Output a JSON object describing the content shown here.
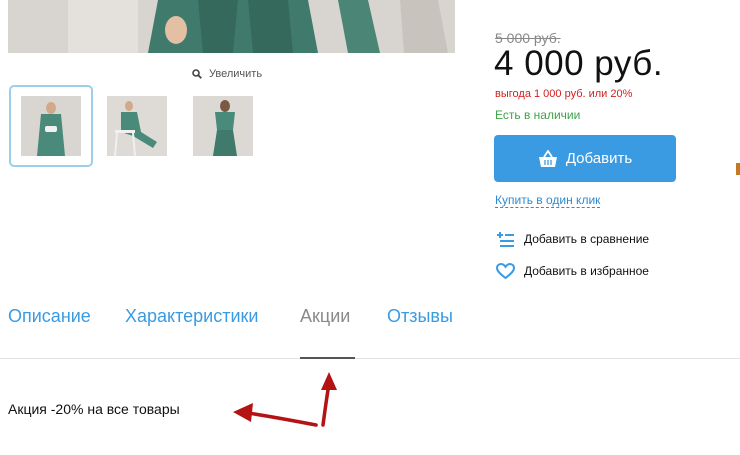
{
  "gallery": {
    "zoom_label": "Увеличить",
    "zoom_icon": "magnifier-icon",
    "thumbnails": [
      "thumb-front",
      "thumb-sitting",
      "thumb-back"
    ]
  },
  "buy_box": {
    "old_price": "5 000 руб.",
    "price": "4 000 руб.",
    "saving": "выгода 1 000 руб. или 20%",
    "stock": "Есть в наличии",
    "add_button_label": "Добавить",
    "add_button_icon": "basket-icon",
    "one_click_label": "Купить в один клик",
    "compare_label": "Добавить в сравнение",
    "compare_icon": "compare-list-icon",
    "favorite_label": "Добавить в избранное",
    "favorite_icon": "heart-icon"
  },
  "tabs": [
    {
      "label": "Описание",
      "active": false
    },
    {
      "label": "Характеристики",
      "active": false
    },
    {
      "label": "Акции",
      "active": true
    },
    {
      "label": "Отзывы",
      "active": false
    }
  ],
  "promo": {
    "text": "Акция -20% на все товары"
  },
  "colors": {
    "accent": "#3a9be3",
    "saving": "#d21f1f",
    "stock": "#3fa24a",
    "annotation": "#b31313"
  }
}
